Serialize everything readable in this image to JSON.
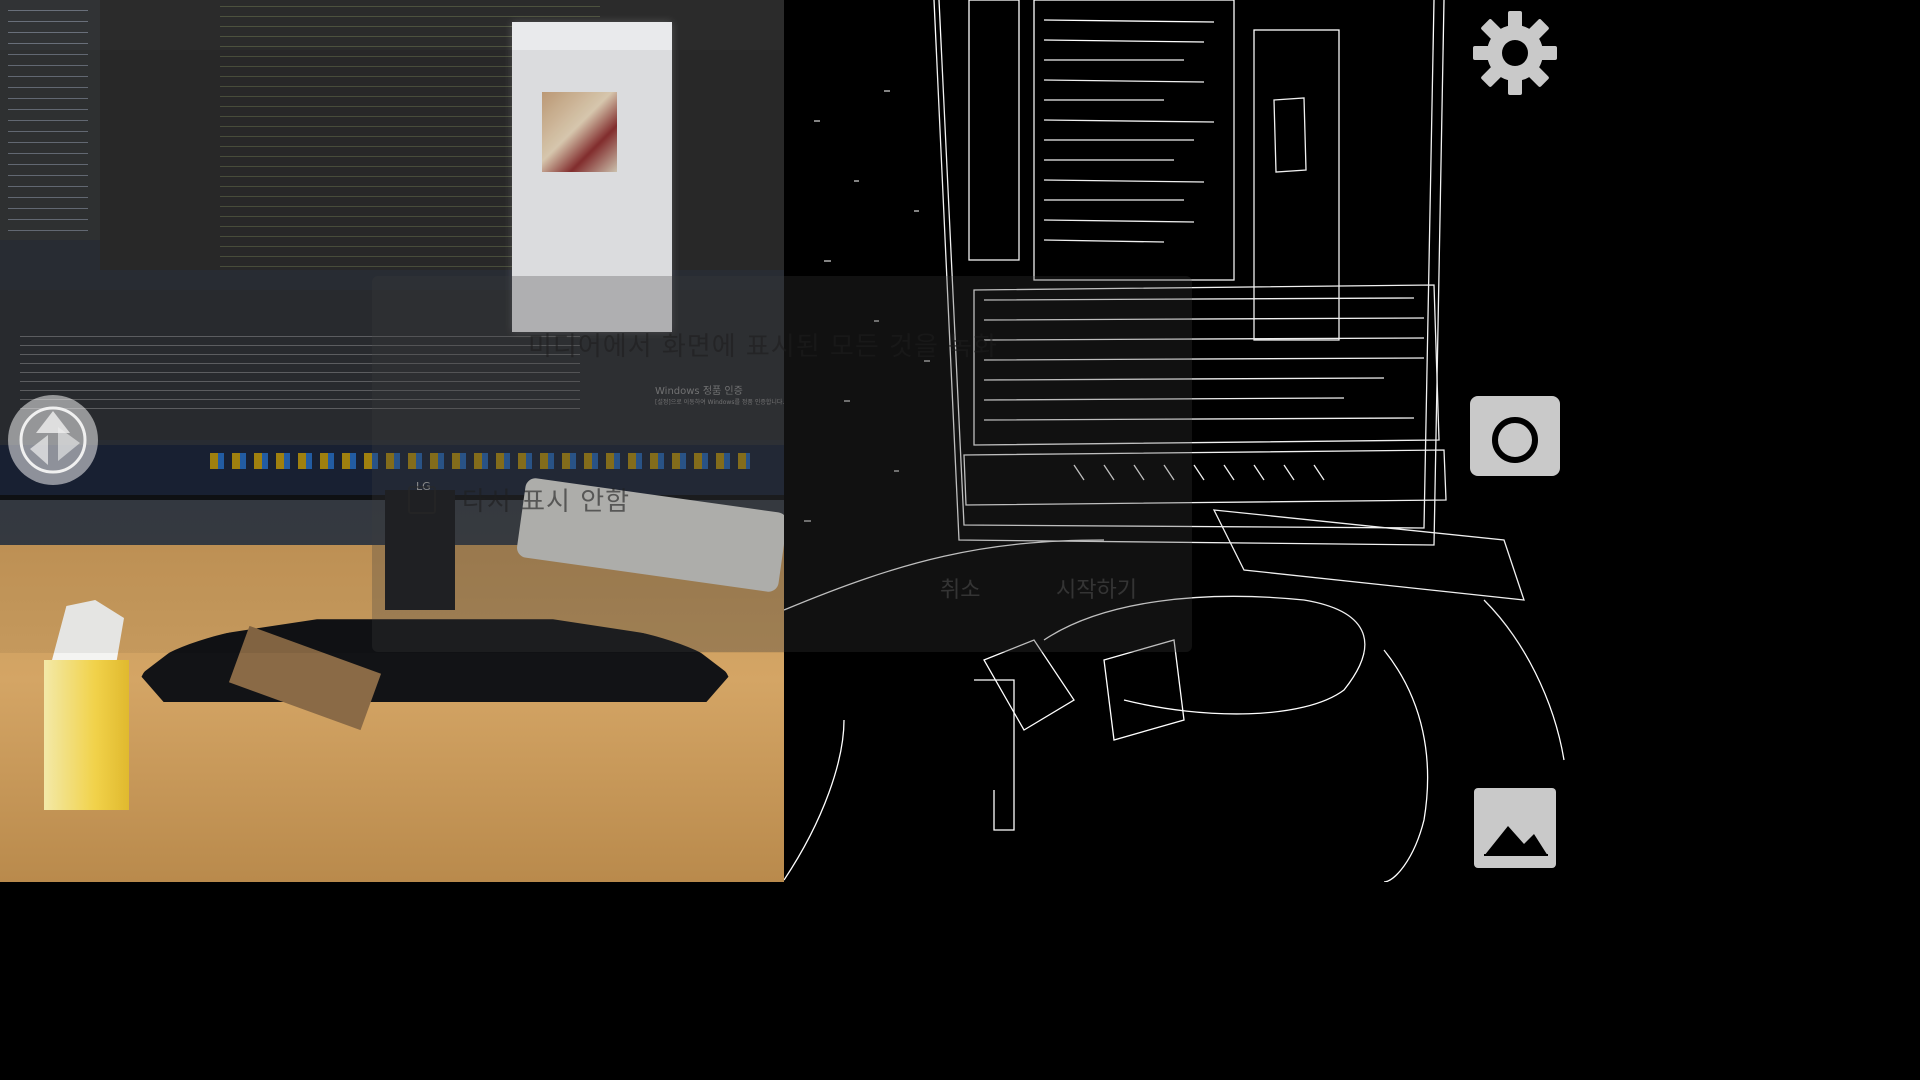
{
  "dialog": {
    "message": "미디어에서 화면에 표시된 모든 것을 녹화",
    "checkbox_label": "다시 표시 안함",
    "cancel_label": "취소",
    "start_label": "시작하기"
  },
  "preview_screen": {
    "windows_notice_title": "Windows 정품 인증",
    "windows_notice_body": "[설정]으로 이동하여 Windows를 정품 인증합니다.",
    "monitor_brand": "LG"
  },
  "controls": {
    "settings_icon": "gear-icon",
    "capture_icon": "camera-icon",
    "gallery_icon": "image-icon",
    "control_color": "#c9c9c9"
  }
}
